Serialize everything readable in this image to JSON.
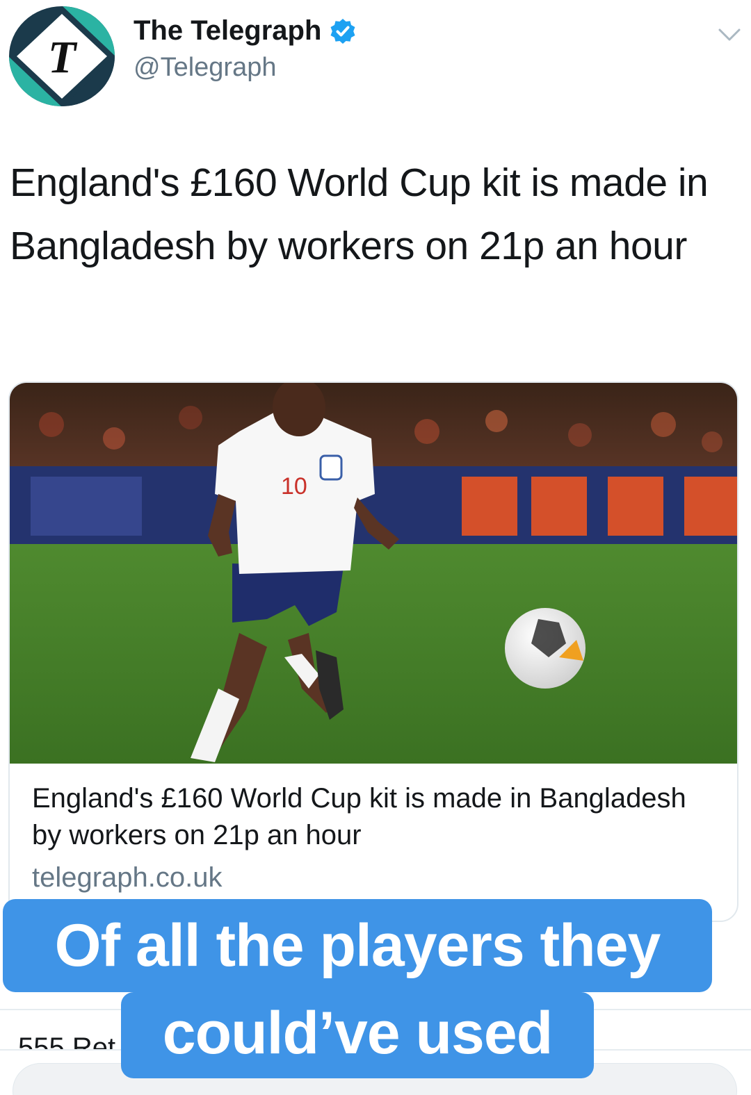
{
  "tweet": {
    "author_name": "The Telegraph",
    "author_handle": "@Telegraph",
    "verified": true,
    "avatar_letter": "T",
    "text": "England's £160 World Cup kit is made in Bangladesh by workers on 21p an hour"
  },
  "card": {
    "title": "England's £160 World Cup kit is made in Bangladesh by workers on 21p an hour",
    "domain": "telegraph.co.uk",
    "jersey_number": "10"
  },
  "footer": {
    "partial_stat": "555 Ret"
  },
  "overlay": {
    "line1": "Of all the players they",
    "line2": "could’ve used"
  },
  "colors": {
    "verified_blue": "#1da1f2",
    "caption_bg": "#3f94e7",
    "secondary_text": "#657786",
    "logo_dark": "#1b3a4b",
    "logo_teal": "#2bb3a3"
  }
}
